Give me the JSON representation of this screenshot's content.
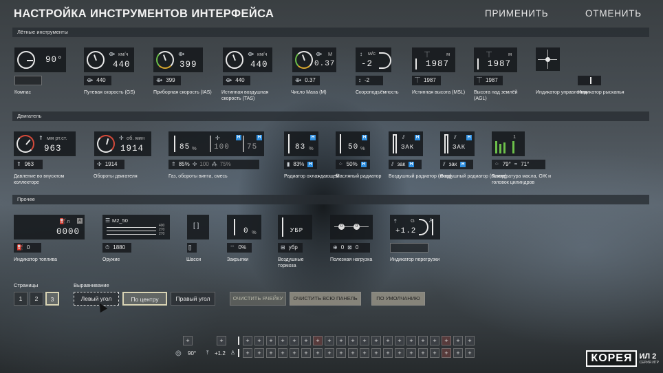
{
  "header": {
    "title": "НАСТРОЙКА ИНСТРУМЕНТОВ ИНТЕРФЕЙСА",
    "apply": "ПРИМЕНИТЬ",
    "cancel": "ОТМЕНИТЬ"
  },
  "sections": {
    "flight": "Лётные инструменты",
    "engine": "Двигатель",
    "other": "Прочее"
  },
  "flight": {
    "compass": {
      "value": "90°",
      "label": "Компас"
    },
    "gs": {
      "unit": "км/ч",
      "big": "440",
      "small": "440",
      "label": "Путевая скорость (GS)"
    },
    "ias": {
      "big": "399",
      "small": "399",
      "label": "Приборная скорость (IAS)"
    },
    "tas": {
      "unit": "км/ч",
      "big": "440",
      "small": "440",
      "label": "Истинная воздушная скорость (TAS)"
    },
    "mach": {
      "unit": "М",
      "big": "0.37",
      "small": "0.37",
      "label": "Число Маха (М)"
    },
    "vs": {
      "unit": "м/с",
      "big": "-2",
      "small": "-2",
      "label": "Скороподъёмность"
    },
    "msl": {
      "unit": "м",
      "big": "1987",
      "small": "1987",
      "label": "Истинная высота (MSL)"
    },
    "agl": {
      "unit": "м",
      "big": "1987",
      "small": "1987",
      "label": "Высота над землёй (AGL)"
    },
    "control": {
      "label": "Индикатор управления"
    },
    "rudder": {
      "label": "Индикатор рысканья"
    }
  },
  "engine": {
    "manifold": {
      "unit": "мм рт.ст.",
      "big": "963",
      "small": "963",
      "label": "Давление во впускном коллекторе"
    },
    "rpm": {
      "unit": "об. мин",
      "big": "1914",
      "small": "1914",
      "label": "Обороты двигателя"
    },
    "throttle": {
      "a": "85",
      "b": "100",
      "c": "75",
      "pct": "%",
      "small_a": "85%",
      "small_b": "100",
      "small_c": "75%",
      "label": "Газ, обороты винта, смесь"
    },
    "radiator_cool": {
      "big": "83",
      "pct": "%",
      "small": "83%",
      "label": "Радиатор охлаждающей"
    },
    "radiator_oil": {
      "big": "50",
      "pct": "%",
      "small": "50%",
      "label": "Масляный радиатор"
    },
    "radiator_in": {
      "big": "ЗАК",
      "small": "зак",
      "label": "Воздушный радиатор (вход)"
    },
    "radiator_out": {
      "big": "ЗАК",
      "small": "зак",
      "label": "Воздушный радиатор (выход)"
    },
    "temps": {
      "small_a": "79°",
      "small_b": "71°",
      "top": "1",
      "label": "Температура масла, ОЖ и головок цилиндров"
    },
    "h": "H"
  },
  "other": {
    "fuel": {
      "unit": "л",
      "tag": "A",
      "big": "0000",
      "small": "0",
      "label": "Индикатор топлива"
    },
    "weapon": {
      "name": "M2_50",
      "r1": "400",
      "r2": "270",
      "r3": "270",
      "small": "1880",
      "label": "Оружие"
    },
    "gear": {
      "label": "Шасси"
    },
    "flaps": {
      "big": "0",
      "pct": "%",
      "small": "0%",
      "label": "Закрылки"
    },
    "airbrake": {
      "big": "УБР",
      "small": "убр",
      "label": "Воздушные тормоза"
    },
    "payload": {
      "a": "0",
      "b": "0",
      "small_a": "0",
      "small_b": "0",
      "label": "Полезная нагрузка"
    },
    "gload": {
      "unit": "G",
      "big": "+1.2",
      "label": "Индикатор перегрузки"
    }
  },
  "bottom": {
    "pages_label": "Страницы",
    "pages": [
      "1",
      "2",
      "3"
    ],
    "align_label": "Выравнивание",
    "align_left": "Левый угол",
    "align_center": "По центру",
    "align_right": "Правый угол",
    "clear_cell": "ОЧИСТИТЬ ЯЧЕЙКУ",
    "clear_panel": "ОЧИСТИТЬ ВСЮ ПАНЕЛЬ",
    "default": "ПО УМОЛЧАНИЮ"
  },
  "hud": {
    "compass": "90°",
    "g": "+1.2",
    "plus": "+"
  },
  "logo": {
    "main": "КОРЕЯ",
    "side": "ИЛ 2",
    "sub": "СЕРИЯ ИГР"
  }
}
